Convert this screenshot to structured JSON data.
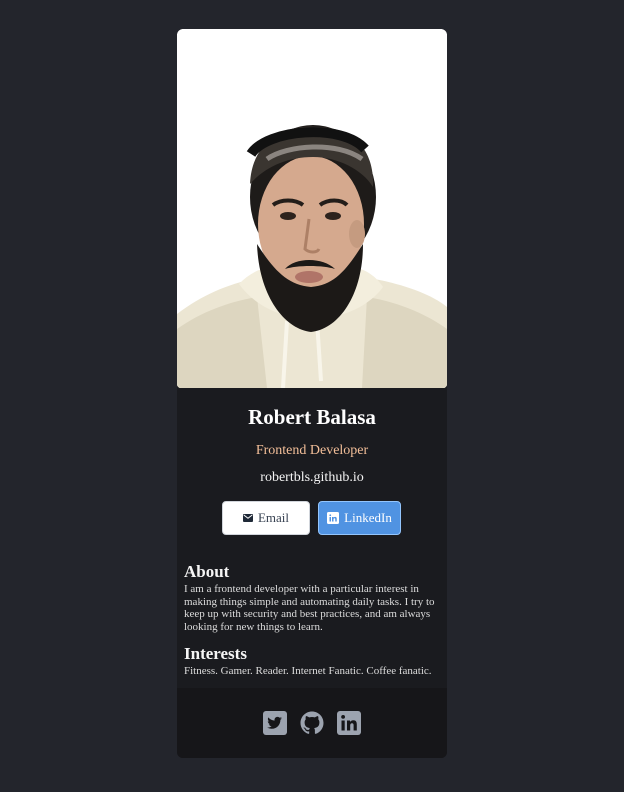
{
  "profile": {
    "name": "Robert Balasa",
    "role": "Frontend Developer",
    "website": "robertbls.github.io",
    "photo_alt": "profile-photo"
  },
  "buttons": {
    "email_label": "Email",
    "linkedin_label": "LinkedIn"
  },
  "about": {
    "title": "About",
    "text": "I am a frontend developer with a particular interest in making things simple and automating daily tasks. I try to keep up with security and best practices, and am always looking for new things to learn."
  },
  "interests": {
    "title": "Interests",
    "text": "Fitness. Gamer. Reader. Internet Fanatic. Coffee fanatic."
  },
  "footer": {
    "icons": [
      "twitter-icon",
      "github-icon",
      "linkedin-icon"
    ]
  },
  "colors": {
    "background": "#23252c",
    "card": "#1a1b1f",
    "footer": "#161619",
    "role": "#f3bf99",
    "linkedin_button": "#5093e2",
    "social_icon": "#9ca3af"
  }
}
